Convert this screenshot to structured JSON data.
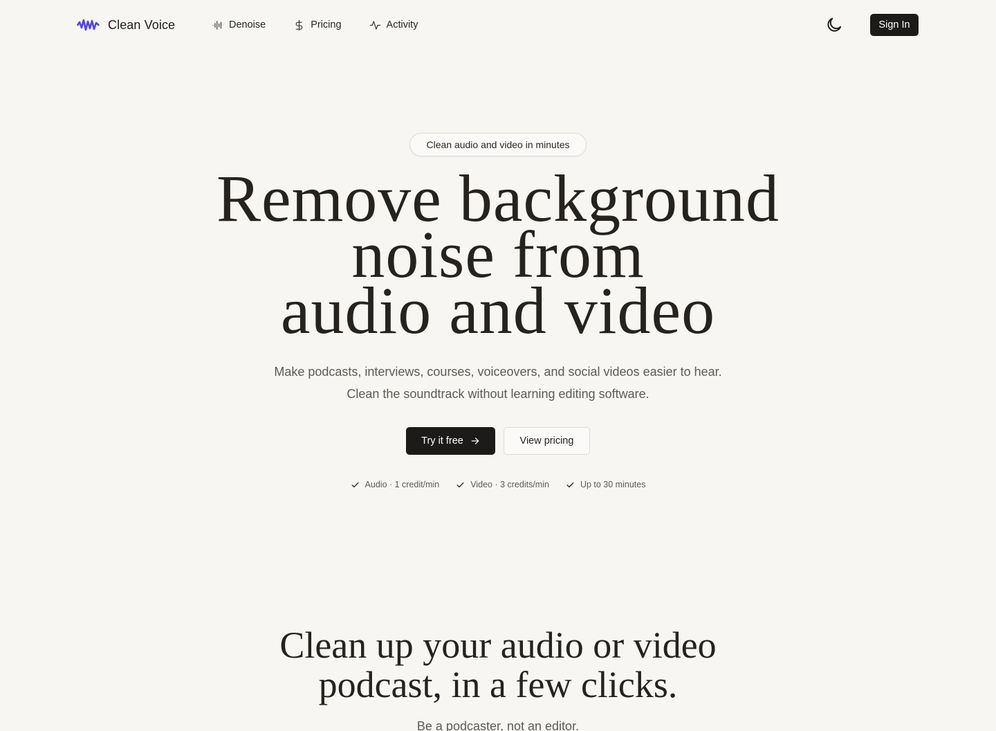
{
  "brand": {
    "name": "Clean Voice",
    "logo_icon": "waveform-logo-icon",
    "accent_color": "#4f46e5"
  },
  "nav": {
    "links": [
      {
        "label": "Denoise",
        "icon": "waveform-icon"
      },
      {
        "label": "Pricing",
        "icon": "dollar-icon"
      },
      {
        "label": "Activity",
        "icon": "activity-pulse-icon"
      }
    ],
    "theme_toggle_icon": "moon-icon",
    "signin_label": "Sign In"
  },
  "hero": {
    "pill": "Clean audio and video in minutes",
    "title_lines": [
      "Remove background",
      "noise from",
      "audio and video"
    ],
    "subtitle": "Make podcasts, interviews, courses, voiceovers, and social videos easier to hear. Clean the soundtrack without learning editing software.",
    "primary_cta": "Try it free",
    "primary_cta_icon": "arrow-right-icon",
    "secondary_cta": "View pricing",
    "features": [
      "Audio · 1 credit/min",
      "Video · 3 credits/min",
      "Up to 30 minutes"
    ],
    "feature_icon": "check-icon"
  },
  "section2": {
    "title_lines": [
      "Clean up your audio or video",
      "podcast, in a few clicks."
    ],
    "subtitle": "Be a podcaster, not an editor."
  },
  "colors": {
    "background": "#f7f6f3",
    "text": "#26231f",
    "muted": "#5e5a55",
    "button_dark": "#1d1b19"
  }
}
